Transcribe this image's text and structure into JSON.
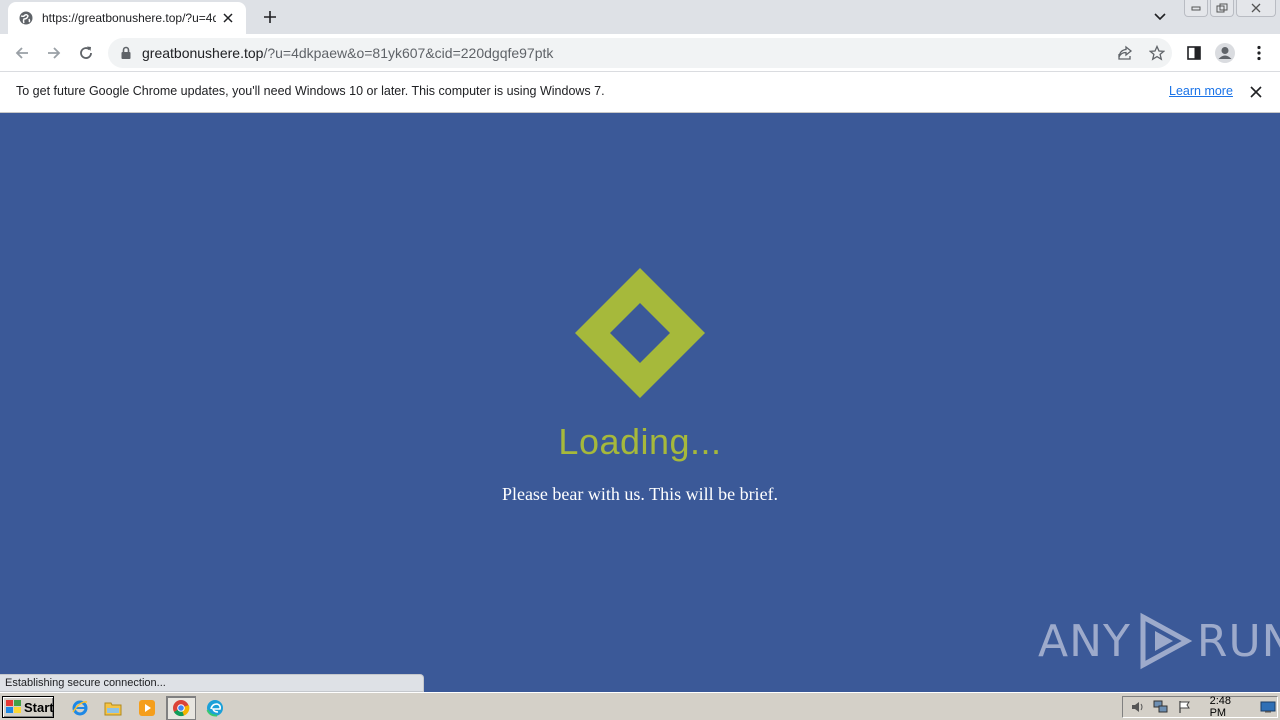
{
  "browser": {
    "tab": {
      "title": "https://greatbonushere.top/?u=4dkpaew&o=81yk607&cid=220dgqfe97ptk"
    },
    "address": {
      "host": "greatbonushere.top",
      "path": "/?u=4dkpaew&o=81yk607&cid=220dgqfe97ptk"
    },
    "infobar": {
      "message": "To get future Google Chrome updates, you'll need Windows 10 or later. This computer is using Windows 7.",
      "link": "Learn more"
    },
    "status": "Establishing secure connection..."
  },
  "page": {
    "heading": "Loading...",
    "subtitle": "Please bear with us. This will be brief.",
    "accent_color": "#a6b93b",
    "background_color": "#3b5998"
  },
  "watermark": {
    "left": "ANY",
    "right": "RUN"
  },
  "taskbar": {
    "start_label": "Start",
    "clock": "2:48 PM",
    "apps": [
      "ie-icon",
      "explorer-icon",
      "media-player-icon",
      "chrome-icon",
      "edge-icon"
    ]
  }
}
